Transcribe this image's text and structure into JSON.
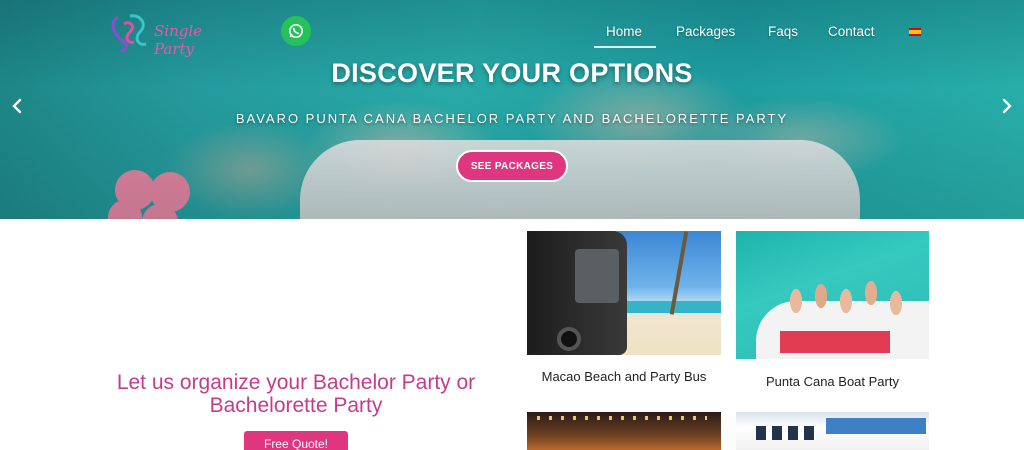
{
  "header": {
    "logo_text": "Single Party",
    "nav": {
      "home": "Home",
      "packages": "Packages",
      "faqs": "Faqs",
      "contact": "Contact"
    },
    "language_flag": "spanish-flag-icon",
    "whatsapp_icon": "whatsapp-icon"
  },
  "hero": {
    "title": "DISCOVER YOUR OPTIONS",
    "subtitle": "BAVARO PUNTA CANA BACHELOR PARTY AND BACHELORETTE PARTY",
    "button": "SEE PACKAGES",
    "prev_icon": "chevron-left-icon",
    "next_icon": "chevron-right-icon"
  },
  "intro": {
    "headline": "Let us organize your Bachelor Party or Bachelorette Party",
    "button": "Free Quote!"
  },
  "cards": [
    {
      "title": "Macao Beach and Party Bus"
    },
    {
      "title": "Punta Cana Boat Party"
    }
  ],
  "colors": {
    "accent_pink": "#e0357f",
    "headline_pink": "#c43c8c",
    "whatsapp_green": "#25c25a"
  }
}
